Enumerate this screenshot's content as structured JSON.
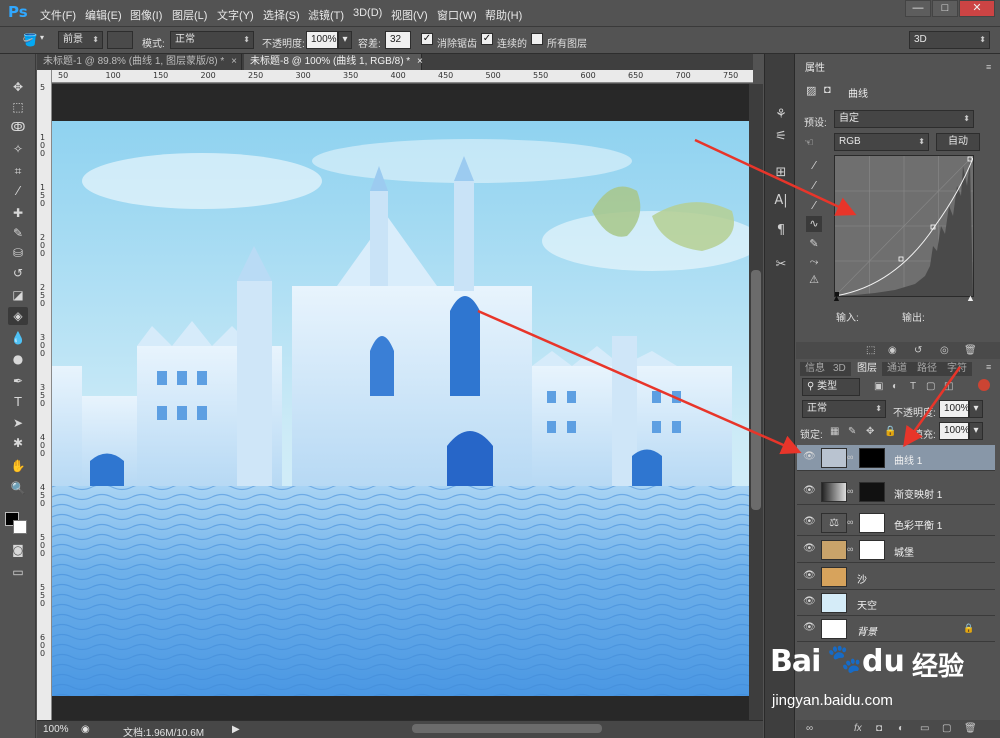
{
  "app": {
    "logo": "Ps",
    "menu": [
      "文件(F)",
      "编辑(E)",
      "图像(I)",
      "图层(L)",
      "文字(Y)",
      "选择(S)",
      "滤镜(T)",
      "3D(D)",
      "视图(V)",
      "窗口(W)",
      "帮助(H)"
    ],
    "window_buttons": [
      "—",
      "□",
      "✕"
    ]
  },
  "options": {
    "fill_source": "前景",
    "mode_label": "模式:",
    "mode_value": "正常",
    "opacity_label": "不透明度:",
    "opacity_value": "100%",
    "tolerance_label": "容差:",
    "tolerance_value": "32",
    "antialias_label": "消除锯齿",
    "antialias_checked": true,
    "contiguous_label": "连续的",
    "contiguous_checked": true,
    "all_layers_label": "所有图层",
    "all_layers_checked": false,
    "workspace": "3D"
  },
  "doc_tabs": [
    {
      "label": "未标题-1 @ 89.8% (曲线 1, 图层蒙版/8) *",
      "close": "×",
      "active": false
    },
    {
      "label": "未标题-8 @ 100% (曲线 1, RGB/8) *",
      "close": "×",
      "active": true
    }
  ],
  "ruler": {
    "h_ticks": [
      "50",
      "100",
      "150",
      "200",
      "250",
      "300",
      "350",
      "400",
      "450",
      "500",
      "550",
      "600",
      "650",
      "700",
      "750"
    ],
    "v_ticks": [
      "5",
      "1 0 0",
      "1 5 0",
      "2 0 0",
      "2 5 0",
      "3 0 0",
      "3 5 0",
      "4 0 0",
      "4 5 0",
      "5 0 0",
      "5 5 0",
      "6 0 0"
    ]
  },
  "status": {
    "zoom": "100%",
    "doc_size": "文档:1.96M/10.6M"
  },
  "properties": {
    "tab": "属性",
    "title": "曲线",
    "preset_label": "预设:",
    "preset_value": "自定",
    "channel": "RGB",
    "auto_button": "自动",
    "input_label": "输入:",
    "output_label": "输出:"
  },
  "layers_panel": {
    "tabs": [
      "信息",
      "3D",
      "图层",
      "通道",
      "路径",
      "字符"
    ],
    "active_tab": "图层",
    "filter_type": "类型",
    "blend_mode": "正常",
    "opacity_label": "不透明度:",
    "opacity_value": "100%",
    "lock_label": "锁定:",
    "fill_label": "填充:",
    "fill_value": "100%",
    "layers": [
      {
        "name": "曲线 1",
        "selected": true
      },
      {
        "name": "渐变映射 1",
        "selected": false
      },
      {
        "name": "色彩平衡 1",
        "selected": false
      },
      {
        "name": "城堡",
        "selected": false
      },
      {
        "name": "沙",
        "selected": false
      },
      {
        "name": "天空",
        "selected": false
      },
      {
        "name": "背景",
        "selected": false
      }
    ]
  },
  "watermark": {
    "brand": "Bai",
    "brand2": "du",
    "tagline": "经验",
    "url": "jingyan.baidu.com"
  },
  "colors": {
    "accent": "#31a8ff",
    "arrow": "#e8352a",
    "selected_layer": "#8897a8",
    "sky": "#a9dcf3",
    "sand": "#5a9ee6"
  }
}
